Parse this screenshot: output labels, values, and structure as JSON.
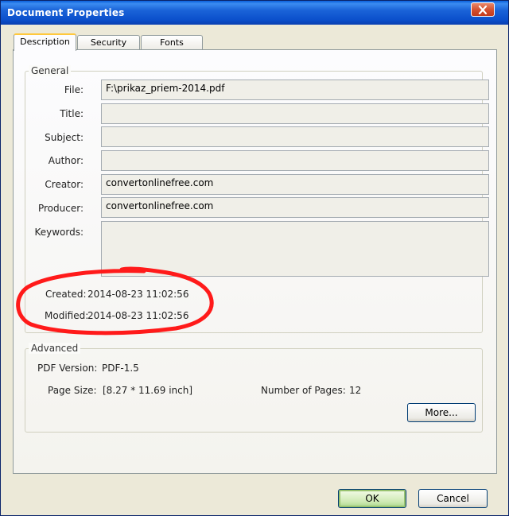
{
  "window": {
    "title": "Document Properties"
  },
  "tabs": [
    {
      "label": "Description",
      "active": true
    },
    {
      "label": "Security",
      "active": false
    },
    {
      "label": "Fonts",
      "active": false
    }
  ],
  "general": {
    "title": "General",
    "file_label": "File:",
    "file_value": "F:\\prikaz_priem-2014.pdf",
    "title_label": "Title:",
    "title_value": "",
    "subject_label": "Subject:",
    "subject_value": "",
    "author_label": "Author:",
    "author_value": "",
    "creator_label": "Creator:",
    "creator_value": "convertonlinefree.com",
    "producer_label": "Producer:",
    "producer_value": "convertonlinefree.com",
    "keywords_label": "Keywords:",
    "keywords_value": "",
    "created_label": "Created:",
    "created_value": "2014-08-23 11:02:56",
    "modified_label": "Modified:",
    "modified_value": "2014-08-23 11:02:56"
  },
  "advanced": {
    "title": "Advanced",
    "pdf_version_label": "PDF Version:",
    "pdf_version_value": "PDF-1.5",
    "page_size_label": "Page Size:",
    "page_size_value": "[8.27 * 11.69 inch]",
    "num_pages_label": "Number of Pages:",
    "num_pages_value": "12",
    "more_button": "More..."
  },
  "buttons": {
    "ok": "OK",
    "cancel": "Cancel"
  },
  "annotation": {
    "color": "#ff1a1a",
    "shape": "hand-drawn-ellipse"
  },
  "icons": {
    "close": "close-icon"
  }
}
